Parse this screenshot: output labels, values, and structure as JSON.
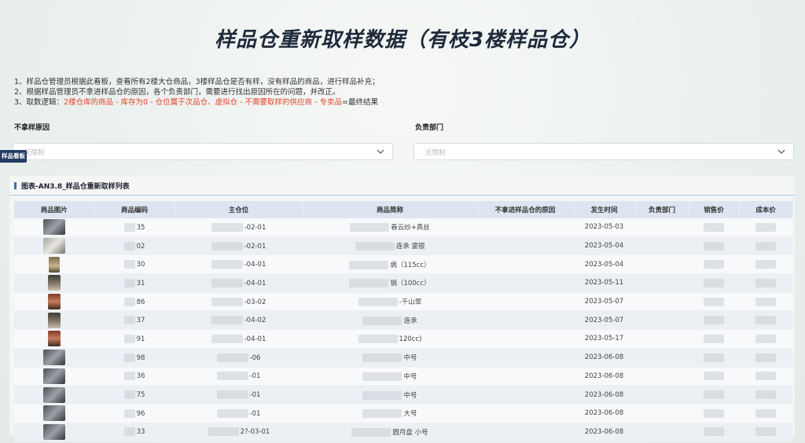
{
  "title": "样品仓重新取样数据（有枝3楼样品仓）",
  "description": {
    "line1": "1、样品仓管理员根据此看板，查看所有2楼大仓商品，3楼样品仓是否有样，没有样品的商品，进行样品补充；",
    "line2": "2、根据样品管理员不拿进样品仓的原因，各个负责部门，需要进行找出原因所在的问题，并改正。",
    "line3_prefix": "3、取数逻辑：",
    "line3_red": "2楼仓库的商品 - 库存为0 - 仓位属于次品仓、虚拟仓 - 不需要取样的供应商 - 专卖品",
    "line3_suffix": "=最终结果"
  },
  "filters": {
    "reason": {
      "label": "不拿样原因",
      "placeholder": "无限制"
    },
    "dept": {
      "label": "负责部门",
      "placeholder": "无限制"
    }
  },
  "side_tab": "样品看板",
  "table": {
    "title": "图表-AN3.8_样品仓重新取样列表",
    "headers": [
      "商品图片",
      "商品编码",
      "主仓位",
      "商品简称",
      "不拿进样品仓的原因",
      "发生时间",
      "负责部门",
      "销售价",
      "成本价"
    ],
    "rows": [
      {
        "code": "35",
        "location": "-02-01",
        "name": "春云纱+真丝",
        "date": "2023-05-03"
      },
      {
        "code": "02",
        "location": "-02-01",
        "name": "连承 鎏银",
        "date": "2023-05-04"
      },
      {
        "code": "30",
        "location": "-04-01",
        "name": "病（115cc）",
        "date": "2023-05-04"
      },
      {
        "code": "31",
        "location": "-04-01",
        "name": "锅（100cc）",
        "date": "2023-05-11"
      },
      {
        "code": "86",
        "location": "-03-02",
        "name": "-千山翠",
        "date": "2023-05-07"
      },
      {
        "code": "37",
        "location": "-04-02",
        "name": "连承",
        "date": "2023-05-07"
      },
      {
        "code": "91",
        "location": "-04-01",
        "name": "120cc)",
        "date": "2023-05-17"
      },
      {
        "code": "98",
        "location": "-06",
        "name": "中号",
        "date": "2023-06-08"
      },
      {
        "code": "36",
        "location": "-01",
        "name": "中号",
        "date": "2023-06-08"
      },
      {
        "code": "75",
        "location": "-01",
        "name": "中号",
        "date": "2023-06-08"
      },
      {
        "code": "96",
        "location": "-01",
        "name": "大号",
        "date": "2023-06-08"
      },
      {
        "code": "33",
        "location": "2?-03-01",
        "name": "圆月盘 小号",
        "date": "2023-06-08"
      }
    ]
  },
  "colors": {
    "accent": "#233a63",
    "header_bg": "#dde5f1",
    "warning_red": "#e0452b"
  }
}
